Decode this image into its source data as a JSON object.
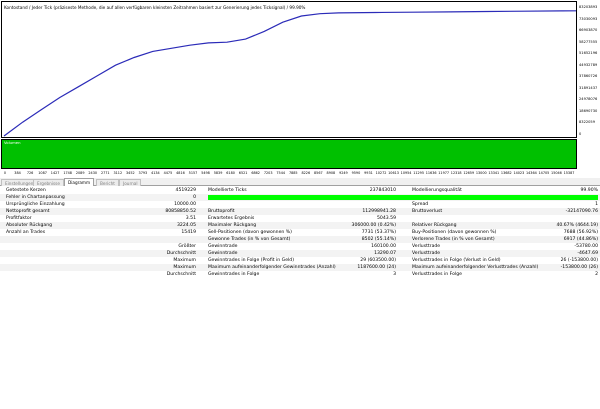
{
  "title": "Kontostand / Jeder Tick (präziseste Methode, die auf allen verfügbaren kleinsten Zeitrahmen basiert zur Generierung jedes Ticksignal) / 99.90%",
  "chart_data": {
    "type": "line",
    "title": "",
    "y_ticks": [
      "83203893",
      "73030093",
      "66903870",
      "58277555",
      "51652196",
      "44932789",
      "37860726",
      "31891437",
      "24978076",
      "18690730",
      "8322059",
      "0"
    ],
    "ylim": [
      0,
      83203893
    ],
    "x_ticks": [
      "0",
      "384",
      "726",
      "1087",
      "1427",
      "1748",
      "2089",
      "2430",
      "2771",
      "3112",
      "3452",
      "3793",
      "4134",
      "4475",
      "4816",
      "5157",
      "5498",
      "5839",
      "6180",
      "6521",
      "6862",
      "7203",
      "7544",
      "7885",
      "8226",
      "8567",
      "8908",
      "9249",
      "9590",
      "9931",
      "10272",
      "10613",
      "10954",
      "11295",
      "11636",
      "11977",
      "12318",
      "12659",
      "13000",
      "13341",
      "13682",
      "14023",
      "14364",
      "14705",
      "15046",
      "15387"
    ],
    "xlim": [
      0,
      15387
    ],
    "series": [
      {
        "color": "#2b2bb8",
        "x": [
          0,
          500,
          1000,
          1500,
          2000,
          2500,
          3000,
          3500,
          4000,
          4500,
          5000,
          5500,
          6000,
          6500,
          7000,
          7500,
          8000,
          8500,
          9000,
          10000,
          11000,
          12000,
          13000,
          14000,
          15000,
          15387
        ],
        "y": [
          0,
          9000000,
          17000000,
          25000000,
          32000000,
          39000000,
          46000000,
          51000000,
          55000000,
          57000000,
          59000000,
          60500000,
          61000000,
          63000000,
          68000000,
          74000000,
          78000000,
          79500000,
          80000000,
          80300000,
          80500000,
          80700000,
          80900000,
          81100000,
          81300000,
          81400000
        ]
      }
    ],
    "volume_label": "Volumen",
    "volume_color": "#00c000"
  },
  "tabs": [
    {
      "label": "Einstellungen",
      "active": false
    },
    {
      "label": "Ergebnisse",
      "active": false
    },
    {
      "label": "Diagramm",
      "active": true
    },
    {
      "label": "Bericht",
      "active": false
    },
    {
      "label": "Journal",
      "active": false
    }
  ],
  "report": {
    "row1": {
      "l1": "Getestete Kerzen",
      "v1": "4519229",
      "l2": "Modellierte Ticks",
      "v2": "237843010",
      "l3": "Modellierungsqualität",
      "v3": "99.90%"
    },
    "row2": {
      "l1": "Fehler in Chartanpassung",
      "v1": "0",
      "bar_fraction": 1.0
    },
    "row3": {
      "l1": "Ursprüngliche Einzahlung",
      "v1": "10000.00",
      "l3": "Spread",
      "v3": "1"
    },
    "row4": {
      "l1": "Nettoprofit gesamt",
      "v1": "80858850.52",
      "l2": "Bruttoprofit",
      "v2": "112998941.28",
      "l3": "Bruttoverlust",
      "v3": "-32147090.76"
    },
    "row5": {
      "l1": "Profitfaktor",
      "v1": "3.51",
      "l2": "Erwartetes Ergebnis",
      "v2": "5043.59"
    },
    "row6": {
      "l1": "Absoluter Rückgang",
      "v1": "3224.05",
      "l2": "Maximaler Rückgang",
      "v2": "306000.00 (0.42%)",
      "l3": "Relativer Rückgang",
      "v3": "40.67% (4644.19)"
    },
    "row7": {
      "l1": "Anzahl an Trades",
      "v1": "15419",
      "l2": "Sell-Positionen (davon gewonnen %)",
      "v2": "7731 (53.37%)",
      "l3": "Buy-Positionen (davon gewonnen %)",
      "v3": "7688 (56.92%)"
    },
    "row8": {
      "l2": "Gewonne Trades (in % von Gesamt)",
      "v2": "8502 (55.14%)",
      "l3": "Verlorene Trades (in % von Gesamt)",
      "v3": "6917 (44.86%)"
    },
    "row9": {
      "l1": "Größter",
      "l2": "Gewinntrade",
      "v2": "160100.00",
      "l3": "Verlusttrade",
      "v3": "-53780.00"
    },
    "row10": {
      "l1": "Durchschnitt",
      "l2": "Gewinntrade",
      "v2": "13290.07",
      "l3": "Verlusttrade",
      "v3": "-4647.69"
    },
    "row11": {
      "l1": "Maximum",
      "l2": "Gewinntrades in Folge (Profit in Geld)",
      "v2": "29 (603500.00)",
      "l3": "Verlusttrades in Folge (Verlust in Geld)",
      "v3": "26 (-153800.00)"
    },
    "row12": {
      "l1": "Maximum",
      "l2": "Maximum aufeinanderfolgender Gewinntrades (Anzahl)",
      "v2": "1187600.00 (24)",
      "l3": "Maximum aufeinanderfolgender Verlusttrades (Anzahl)",
      "v3": "-153800.00 (26)"
    },
    "row13": {
      "l1": "Durchschnitt",
      "l2": "Gewinntrades in Folge",
      "v2": "3",
      "l3": "Verlusttrades in Folge",
      "v3": "2"
    }
  }
}
